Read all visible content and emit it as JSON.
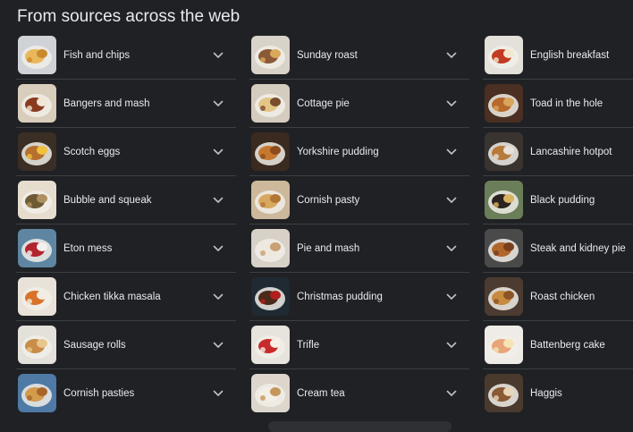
{
  "heading": "From sources across the web",
  "columns": [
    {
      "items": [
        {
          "label": "Fish and chips",
          "thumb": "fish-and-chips-photo",
          "c1": "#e8b85a",
          "c2": "#c98a2e",
          "bg": "#cfd2d6"
        },
        {
          "label": "Bangers and mash",
          "thumb": "bangers-and-mash-photo",
          "c1": "#8a3b1f",
          "c2": "#efe6d6",
          "bg": "#d9cdbb"
        },
        {
          "label": "Scotch eggs",
          "thumb": "scotch-eggs-photo",
          "c1": "#b5702e",
          "c2": "#f2c13b",
          "bg": "#3b2e24"
        },
        {
          "label": "Bubble and squeak",
          "thumb": "bubble-and-squeak-photo",
          "c1": "#6e5a34",
          "c2": "#b09060",
          "bg": "#e6ddcf"
        },
        {
          "label": "Eton mess",
          "thumb": "eton-mess-photo",
          "c1": "#b3242f",
          "c2": "#f4f1ee",
          "bg": "#5e86a3"
        },
        {
          "label": "Chicken tikka masala",
          "thumb": "chicken-tikka-masala-photo",
          "c1": "#d9722a",
          "c2": "#f3ece4",
          "bg": "#e9e2d8"
        },
        {
          "label": "Sausage rolls",
          "thumb": "sausage-rolls-photo",
          "c1": "#c78d49",
          "c2": "#e9c68c",
          "bg": "#e4e0da"
        },
        {
          "label": "Cornish pasties",
          "thumb": "cornish-pasties-photo",
          "c1": "#d39b4c",
          "c2": "#a8652a",
          "bg": "#4f7aa5"
        }
      ]
    },
    {
      "items": [
        {
          "label": "Sunday roast",
          "thumb": "sunday-roast-photo",
          "c1": "#8a5a36",
          "c2": "#d9a85a",
          "bg": "#d8d2c8"
        },
        {
          "label": "Cottage pie",
          "thumb": "cottage-pie-photo",
          "c1": "#e3c685",
          "c2": "#7a4b2c",
          "bg": "#d4ccbf"
        },
        {
          "label": "Yorkshire pudding",
          "thumb": "yorkshire-pudding-photo",
          "c1": "#c7782f",
          "c2": "#8e4c1d",
          "bg": "#3a2a1f"
        },
        {
          "label": "Cornish pasty",
          "thumb": "cornish-pasty-photo",
          "c1": "#d9a860",
          "c2": "#b17535",
          "bg": "#cdb89b"
        },
        {
          "label": "Pie and mash",
          "thumb": "pie-and-mash-photo",
          "c1": "#efe8dc",
          "c2": "#c7a074",
          "bg": "#d7d1c7"
        },
        {
          "label": "Christmas pudding",
          "thumb": "christmas-pudding-photo",
          "c1": "#4a2a1a",
          "c2": "#b01e1e",
          "bg": "#1f2a33"
        },
        {
          "label": "Trifle",
          "thumb": "trifle-photo",
          "c1": "#c72a2a",
          "c2": "#f6efe4",
          "bg": "#e7e3dd"
        },
        {
          "label": "Cream tea",
          "thumb": "cream-tea-photo",
          "c1": "#f4efe6",
          "c2": "#c4965c",
          "bg": "#dcd6cc"
        }
      ]
    },
    {
      "items": [
        {
          "label": "English breakfast",
          "thumb": "english-breakfast-photo",
          "c1": "#c23b22",
          "c2": "#f3e7cf",
          "bg": "#e4e0da"
        },
        {
          "label": "Toad in the hole",
          "thumb": "toad-in-the-hole-photo",
          "c1": "#b8692b",
          "c2": "#d9a45c",
          "bg": "#4a2f22"
        },
        {
          "label": "Lancashire hotpot",
          "thumb": "lancashire-hotpot-photo",
          "c1": "#b77a3a",
          "c2": "#e6e1da",
          "bg": "#3a3430"
        },
        {
          "label": "Black pudding",
          "thumb": "black-pudding-photo",
          "c1": "#2b2320",
          "c2": "#d8b35f",
          "bg": "#6b7e5a"
        },
        {
          "label": "Steak and kidney pie",
          "thumb": "steak-and-kidney-pie-photo",
          "c1": "#b0672c",
          "c2": "#7a3f1d",
          "bg": "#4a4a4a"
        },
        {
          "label": "Roast chicken",
          "thumb": "roast-chicken-photo",
          "c1": "#c78a3e",
          "c2": "#8c5424",
          "bg": "#4b3b30"
        },
        {
          "label": "Battenberg cake",
          "thumb": "battenberg-cake-photo",
          "c1": "#e9a47a",
          "c2": "#f6e4b3",
          "bg": "#efece8"
        },
        {
          "label": "Haggis",
          "thumb": "haggis-photo",
          "c1": "#8a5a34",
          "c2": "#e7d7b8",
          "bg": "#4a3a2e"
        }
      ]
    }
  ],
  "chevron_icon": "chevron-down-icon"
}
